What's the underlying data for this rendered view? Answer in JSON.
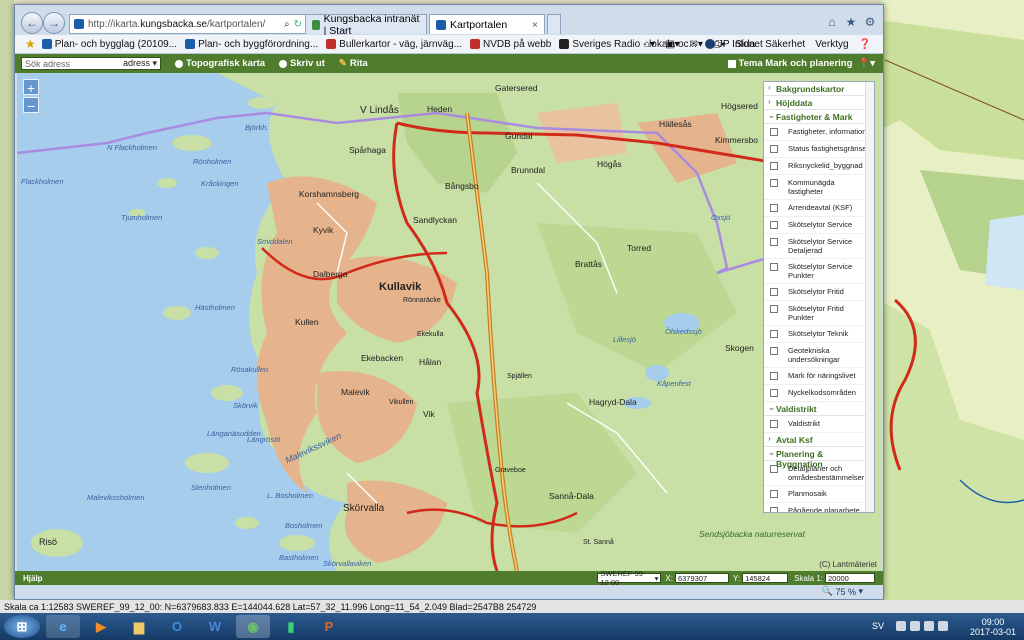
{
  "browser": {
    "url_prefix": "http://ikarta.",
    "url_host": "kungsbacka.se",
    "url_path": "/kartportalen/",
    "tabs": [
      {
        "label": "Kungsbacka intranät | Start"
      },
      {
        "label": "Kartportalen"
      }
    ],
    "favorites": [
      {
        "label": "Plan- och bygglag (20109..."
      },
      {
        "label": "Plan- och byggförordning..."
      },
      {
        "label": "Bullerkartor - väg, järnväg..."
      },
      {
        "label": "NVDB på webb"
      },
      {
        "label": "Sveriges Radio - lokala oc..."
      },
      {
        "label": "JP Infonet"
      }
    ],
    "commands": {
      "page": "Sida",
      "security": "Säkerhet",
      "tools": "Verktyg"
    }
  },
  "toolbar": {
    "address_placeholder": "Sök adress",
    "address_mode": "adress",
    "topo_label": "Topografisk karta",
    "print_label": "Skriv ut",
    "draw_label": "Rita",
    "theme_label": "Tema Mark och planering"
  },
  "map": {
    "zoom_in": "+",
    "zoom_out": "−",
    "attribution": "(C) Lantmäteriet",
    "places": [
      "Gatersered",
      "V Lindås",
      "Heden",
      "Gundal",
      "Högsered",
      "Hällesås",
      "Kimmersbo",
      "Spårhaga",
      "Brunndal",
      "Högås",
      "Bångsbo",
      "Korshamnsberg",
      "Sandlyckan",
      "Kyvik",
      "Torred",
      "Brattås",
      "Kullavik",
      "Dalberga",
      "Kullen",
      "Rönnaräcke",
      "Ekekulla",
      "Ekebacken",
      "Hålan",
      "Malevik",
      "Spjällen",
      "Hagryd-Dala",
      "Vik",
      "Skogen",
      "Skörvalla",
      "Sannå-Dala",
      "St. Sannå",
      "Vikullen",
      "Graveboe",
      "Risö",
      "Hästholmen",
      "Rönholmen",
      "Kråckingen",
      "Tjumholmen",
      "Flackholmen",
      "N Flackholmen",
      "Björkh.",
      "Smiddalen",
      "Rösakullen",
      "Länganäsudden",
      "Skörvik",
      "Stenholmen",
      "L. Bosholmen",
      "Bosholmen",
      "Bastholmen",
      "Malevikssholmen",
      "Längrösöt"
    ],
    "sea_labels": [
      "Malevikssviken",
      "Lillesjö",
      "Ölskedssjö",
      "Oxsjö",
      "Skörvallaviken",
      "Sendsjöbacka naturreservat",
      "Ömarsjön",
      "Kåpenfest"
    ]
  },
  "layers": {
    "groups": [
      {
        "label": "Bakgrundskartor",
        "open": false,
        "items": []
      },
      {
        "label": "Höjddata",
        "open": false,
        "items": []
      },
      {
        "label": "Fastigheter & Mark",
        "open": true,
        "items": [
          "Fastigheter, information",
          "Status fastighetsgränser",
          "Riksnyckelid_byggnad",
          "Kommunägda fastigheter",
          "Arrendeavtal (KSF)",
          "Skötselytor Service",
          "Skötselytor Service Detaljerad",
          "Skötselytor Service Punkter",
          "Skötselytor Fritid",
          "Skötselytor Fritid Punkter",
          "Skötselytor Teknik",
          "Geotekniska undersökningar",
          "Mark för näringslivet",
          "Nyckelkodsområden"
        ]
      },
      {
        "label": "Valdistrikt",
        "open": true,
        "items": [
          "Valdistrikt"
        ]
      },
      {
        "label": "Avtal Ksf",
        "open": false,
        "items": []
      },
      {
        "label": "Planering & Byggnation",
        "open": true,
        "items": [
          "Detaljplaner och områdesbestämmelser",
          "Planmosaik",
          "Pågående planarbete"
        ]
      }
    ]
  },
  "status": {
    "help": "Hjälp",
    "crs": "SWEREF 99 12 00",
    "x_label": "X:",
    "x_value": "6379307",
    "y_label": "Y:",
    "y_value": "145824",
    "scale_label": "Skala 1:",
    "scale_value": "20000",
    "browser_zoom": "75 %"
  },
  "coordbar": "Skala ca 1:12583   SWEREF_99_12_00: N=6379683.833  E=144044.628  Lat=57_32_11.996  Long=11_54_2.049  Blad=2547B8 254729",
  "taskbar": {
    "lang": "SV",
    "time": "09:00",
    "date": "2017-03-01"
  },
  "colors": {
    "accent_green": "#4f7d2d",
    "sea": "#a6cdec",
    "land": "#c8dfa6",
    "urban": "#e6b48c",
    "road": "#d22a1a",
    "boundary": "#a98be0"
  }
}
